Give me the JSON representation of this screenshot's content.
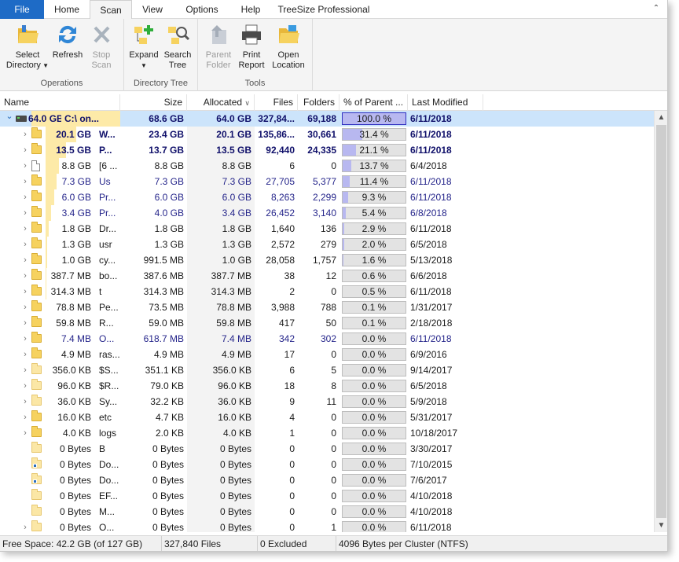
{
  "tabs": [
    {
      "label": "File",
      "name": "tab-file"
    },
    {
      "label": "Home",
      "name": "tab-home"
    },
    {
      "label": "Scan",
      "name": "tab-scan"
    },
    {
      "label": "View",
      "name": "tab-view"
    },
    {
      "label": "Options",
      "name": "tab-options"
    },
    {
      "label": "Help",
      "name": "tab-help"
    },
    {
      "label": "TreeSize Professional",
      "name": "tab-treesize-professional"
    }
  ],
  "ribbon": {
    "select_directory": "Select\nDirectory",
    "select_directory_l1": "Select",
    "select_directory_l2": "Directory",
    "refresh": "Refresh",
    "stop_l1": "Stop",
    "stop_l2": "Scan",
    "operations": "Operations",
    "expand": "Expand",
    "search_l1": "Search",
    "search_l2": "Tree",
    "directory_tree": "Directory Tree",
    "parent_l1": "Parent",
    "parent_l2": "Folder",
    "print_l1": "Print",
    "print_l2": "Report",
    "open_l1": "Open",
    "open_l2": "Location",
    "tools": "Tools"
  },
  "columns": {
    "name": "Name",
    "size": "Size",
    "allocated": "Allocated",
    "files": "Files",
    "folders": "Folders",
    "percent": "% of Parent ...",
    "modified": "Last Modified"
  },
  "rows": [
    {
      "level": 0,
      "icon": "drive",
      "expand": "open",
      "style": "bold",
      "selected": true,
      "alloc": "64.0 GB",
      "name": "C:\\  on...",
      "size": "68.6 GB",
      "allocated": "64.0 GB",
      "files": "327,84...",
      "folders": "69,188",
      "pct_text": "100.0 %",
      "pct": 100,
      "modified": "6/11/2018"
    },
    {
      "level": 1,
      "icon": "folder",
      "expand": "closed",
      "style": "bold",
      "alloc": "20.1 GB",
      "name": "W...",
      "size": "23.4 GB",
      "allocated": "20.1 GB",
      "files": "135,86...",
      "folders": "30,661",
      "pct_text": "31.4 %",
      "pct": 31.4,
      "modified": "6/11/2018"
    },
    {
      "level": 1,
      "icon": "folder",
      "expand": "closed",
      "style": "bold",
      "alloc": "13.5 GB",
      "name": "P...",
      "size": "13.7 GB",
      "allocated": "13.5 GB",
      "files": "92,440",
      "folders": "24,335",
      "pct_text": "21.1 %",
      "pct": 21.1,
      "modified": "6/11/2018"
    },
    {
      "level": 1,
      "icon": "file",
      "expand": "closed",
      "style": "",
      "alloc": "8.8 GB",
      "name": "[6 ...",
      "size": "8.8 GB",
      "allocated": "8.8 GB",
      "files": "6",
      "folders": "0",
      "pct_text": "13.7 %",
      "pct": 13.7,
      "modified": "6/4/2018"
    },
    {
      "level": 1,
      "icon": "folder",
      "expand": "closed",
      "style": "navy",
      "alloc": "7.3 GB",
      "name": "Us",
      "size": "7.3 GB",
      "allocated": "7.3 GB",
      "files": "27,705",
      "folders": "5,377",
      "pct_text": "11.4 %",
      "pct": 11.4,
      "modified": "6/11/2018"
    },
    {
      "level": 1,
      "icon": "folder",
      "expand": "closed",
      "style": "navy",
      "alloc": "6.0 GB",
      "name": "Pr...",
      "size": "6.0 GB",
      "allocated": "6.0 GB",
      "files": "8,263",
      "folders": "2,299",
      "pct_text": "9.3 %",
      "pct": 9.3,
      "modified": "6/11/2018"
    },
    {
      "level": 1,
      "icon": "folder",
      "expand": "closed",
      "style": "navy",
      "alloc": "3.4 GB",
      "name": "Pr...",
      "size": "4.0 GB",
      "allocated": "3.4 GB",
      "files": "26,452",
      "folders": "3,140",
      "pct_text": "5.4 %",
      "pct": 5.4,
      "modified": "6/8/2018"
    },
    {
      "level": 1,
      "icon": "folder",
      "expand": "closed",
      "style": "",
      "alloc": "1.8 GB",
      "name": "Dr...",
      "size": "1.8 GB",
      "allocated": "1.8 GB",
      "files": "1,640",
      "folders": "136",
      "pct_text": "2.9 %",
      "pct": 2.9,
      "modified": "6/11/2018"
    },
    {
      "level": 1,
      "icon": "folder",
      "expand": "closed",
      "style": "",
      "alloc": "1.3 GB",
      "name": "usr",
      "size": "1.3 GB",
      "allocated": "1.3 GB",
      "files": "2,572",
      "folders": "279",
      "pct_text": "2.0 %",
      "pct": 2.0,
      "modified": "6/5/2018"
    },
    {
      "level": 1,
      "icon": "folder",
      "expand": "closed",
      "style": "",
      "alloc": "1.0 GB",
      "name": "cy...",
      "size": "991.5 MB",
      "allocated": "1.0 GB",
      "files": "28,058",
      "folders": "1,757",
      "pct_text": "1.6 %",
      "pct": 1.6,
      "modified": "5/13/2018"
    },
    {
      "level": 1,
      "icon": "folder",
      "expand": "closed",
      "style": "",
      "alloc": "387.7 MB",
      "name": "bo...",
      "size": "387.6 MB",
      "allocated": "387.7 MB",
      "files": "38",
      "folders": "12",
      "pct_text": "0.6 %",
      "pct": 0.6,
      "modified": "6/6/2018"
    },
    {
      "level": 1,
      "icon": "folder",
      "expand": "closed",
      "style": "",
      "alloc": "314.3 MB",
      "name": "t",
      "size": "314.3 MB",
      "allocated": "314.3 MB",
      "files": "2",
      "folders": "0",
      "pct_text": "0.5 %",
      "pct": 0.5,
      "modified": "6/11/2018"
    },
    {
      "level": 1,
      "icon": "folder",
      "expand": "closed",
      "style": "",
      "alloc": "78.8 MB",
      "name": "Pe...",
      "size": "73.5 MB",
      "allocated": "78.8 MB",
      "files": "3,988",
      "folders": "788",
      "pct_text": "0.1 %",
      "pct": 0.1,
      "modified": "1/31/2017"
    },
    {
      "level": 1,
      "icon": "folder",
      "expand": "closed",
      "style": "",
      "alloc": "59.8 MB",
      "name": "R...",
      "size": "59.0 MB",
      "allocated": "59.8 MB",
      "files": "417",
      "folders": "50",
      "pct_text": "0.1 %",
      "pct": 0.1,
      "modified": "2/18/2018"
    },
    {
      "level": 1,
      "icon": "folder",
      "expand": "closed",
      "style": "navy",
      "alloc": "7.4 MB",
      "name": "O...",
      "size": "618.7 MB",
      "allocated": "7.4 MB",
      "files": "342",
      "folders": "302",
      "pct_text": "0.0 %",
      "pct": 0,
      "modified": "6/11/2018"
    },
    {
      "level": 1,
      "icon": "folder",
      "expand": "closed",
      "style": "",
      "alloc": "4.9 MB",
      "name": "ras...",
      "size": "4.9 MB",
      "allocated": "4.9 MB",
      "files": "17",
      "folders": "0",
      "pct_text": "0.0 %",
      "pct": 0,
      "modified": "6/9/2016"
    },
    {
      "level": 1,
      "icon": "folder-pale",
      "expand": "closed",
      "style": "",
      "alloc": "356.0 KB",
      "name": "$S...",
      "size": "351.1 KB",
      "allocated": "356.0 KB",
      "files": "6",
      "folders": "5",
      "pct_text": "0.0 %",
      "pct": 0,
      "modified": "9/14/2017"
    },
    {
      "level": 1,
      "icon": "folder-pale",
      "expand": "closed",
      "style": "",
      "alloc": "96.0 KB",
      "name": "$R...",
      "size": "79.0 KB",
      "allocated": "96.0 KB",
      "files": "18",
      "folders": "8",
      "pct_text": "0.0 %",
      "pct": 0,
      "modified": "6/5/2018"
    },
    {
      "level": 1,
      "icon": "folder-pale",
      "expand": "closed",
      "style": "",
      "alloc": "36.0 KB",
      "name": "Sy...",
      "size": "32.2 KB",
      "allocated": "36.0 KB",
      "files": "9",
      "folders": "11",
      "pct_text": "0.0 %",
      "pct": 0,
      "modified": "5/9/2018"
    },
    {
      "level": 1,
      "icon": "folder",
      "expand": "closed",
      "style": "",
      "alloc": "16.0 KB",
      "name": "etc",
      "size": "4.7 KB",
      "allocated": "16.0 KB",
      "files": "4",
      "folders": "0",
      "pct_text": "0.0 %",
      "pct": 0,
      "modified": "5/31/2017"
    },
    {
      "level": 1,
      "icon": "folder",
      "expand": "closed",
      "style": "",
      "alloc": "4.0 KB",
      "name": "logs",
      "size": "2.0 KB",
      "allocated": "4.0 KB",
      "files": "1",
      "folders": "0",
      "pct_text": "0.0 %",
      "pct": 0,
      "modified": "10/18/2017"
    },
    {
      "level": 1,
      "icon": "folder-pale",
      "expand": "none",
      "style": "",
      "alloc": "0 Bytes",
      "name": "B",
      "size": "0 Bytes",
      "allocated": "0 Bytes",
      "files": "0",
      "folders": "0",
      "pct_text": "0.0 %",
      "pct": 0,
      "modified": "3/30/2017"
    },
    {
      "level": 1,
      "icon": "folder-link",
      "expand": "none",
      "style": "",
      "alloc": "0 Bytes",
      "name": "Do...",
      "size": "0 Bytes",
      "allocated": "0 Bytes",
      "files": "0",
      "folders": "0",
      "pct_text": "0.0 %",
      "pct": 0,
      "modified": "7/10/2015"
    },
    {
      "level": 1,
      "icon": "folder-link",
      "expand": "none",
      "style": "",
      "alloc": "0 Bytes",
      "name": "Do...",
      "size": "0 Bytes",
      "allocated": "0 Bytes",
      "files": "0",
      "folders": "0",
      "pct_text": "0.0 %",
      "pct": 0,
      "modified": "7/6/2017"
    },
    {
      "level": 1,
      "icon": "folder-pale",
      "expand": "none",
      "style": "",
      "alloc": "0 Bytes",
      "name": "EF...",
      "size": "0 Bytes",
      "allocated": "0 Bytes",
      "files": "0",
      "folders": "0",
      "pct_text": "0.0 %",
      "pct": 0,
      "modified": "4/10/2018"
    },
    {
      "level": 1,
      "icon": "folder-pale",
      "expand": "none",
      "style": "",
      "alloc": "0 Bytes",
      "name": "M...",
      "size": "0 Bytes",
      "allocated": "0 Bytes",
      "files": "0",
      "folders": "0",
      "pct_text": "0.0 %",
      "pct": 0,
      "modified": "4/10/2018"
    },
    {
      "level": 1,
      "icon": "folder-pale",
      "expand": "closed",
      "style": "",
      "alloc": "0 Bytes",
      "name": "O...",
      "size": "0 Bytes",
      "allocated": "0 Bytes",
      "files": "0",
      "folders": "1",
      "pct_text": "0.0 %",
      "pct": 0,
      "modified": "6/11/2018"
    }
  ],
  "status": {
    "free_space": "Free Space: 42.2 GB  (of 127 GB)",
    "files": "327,840  Files",
    "excluded": "0 Excluded",
    "cluster": "4096  Bytes per Cluster (NTFS)"
  },
  "colors": {
    "file_tab": "#1e6bc6",
    "selected_row": "#cce4fb",
    "name_bar": "#fdeaa8",
    "percent_fill": "#b8b8f0",
    "percent_full": "#4040e0",
    "bold_text": "#10106a"
  }
}
